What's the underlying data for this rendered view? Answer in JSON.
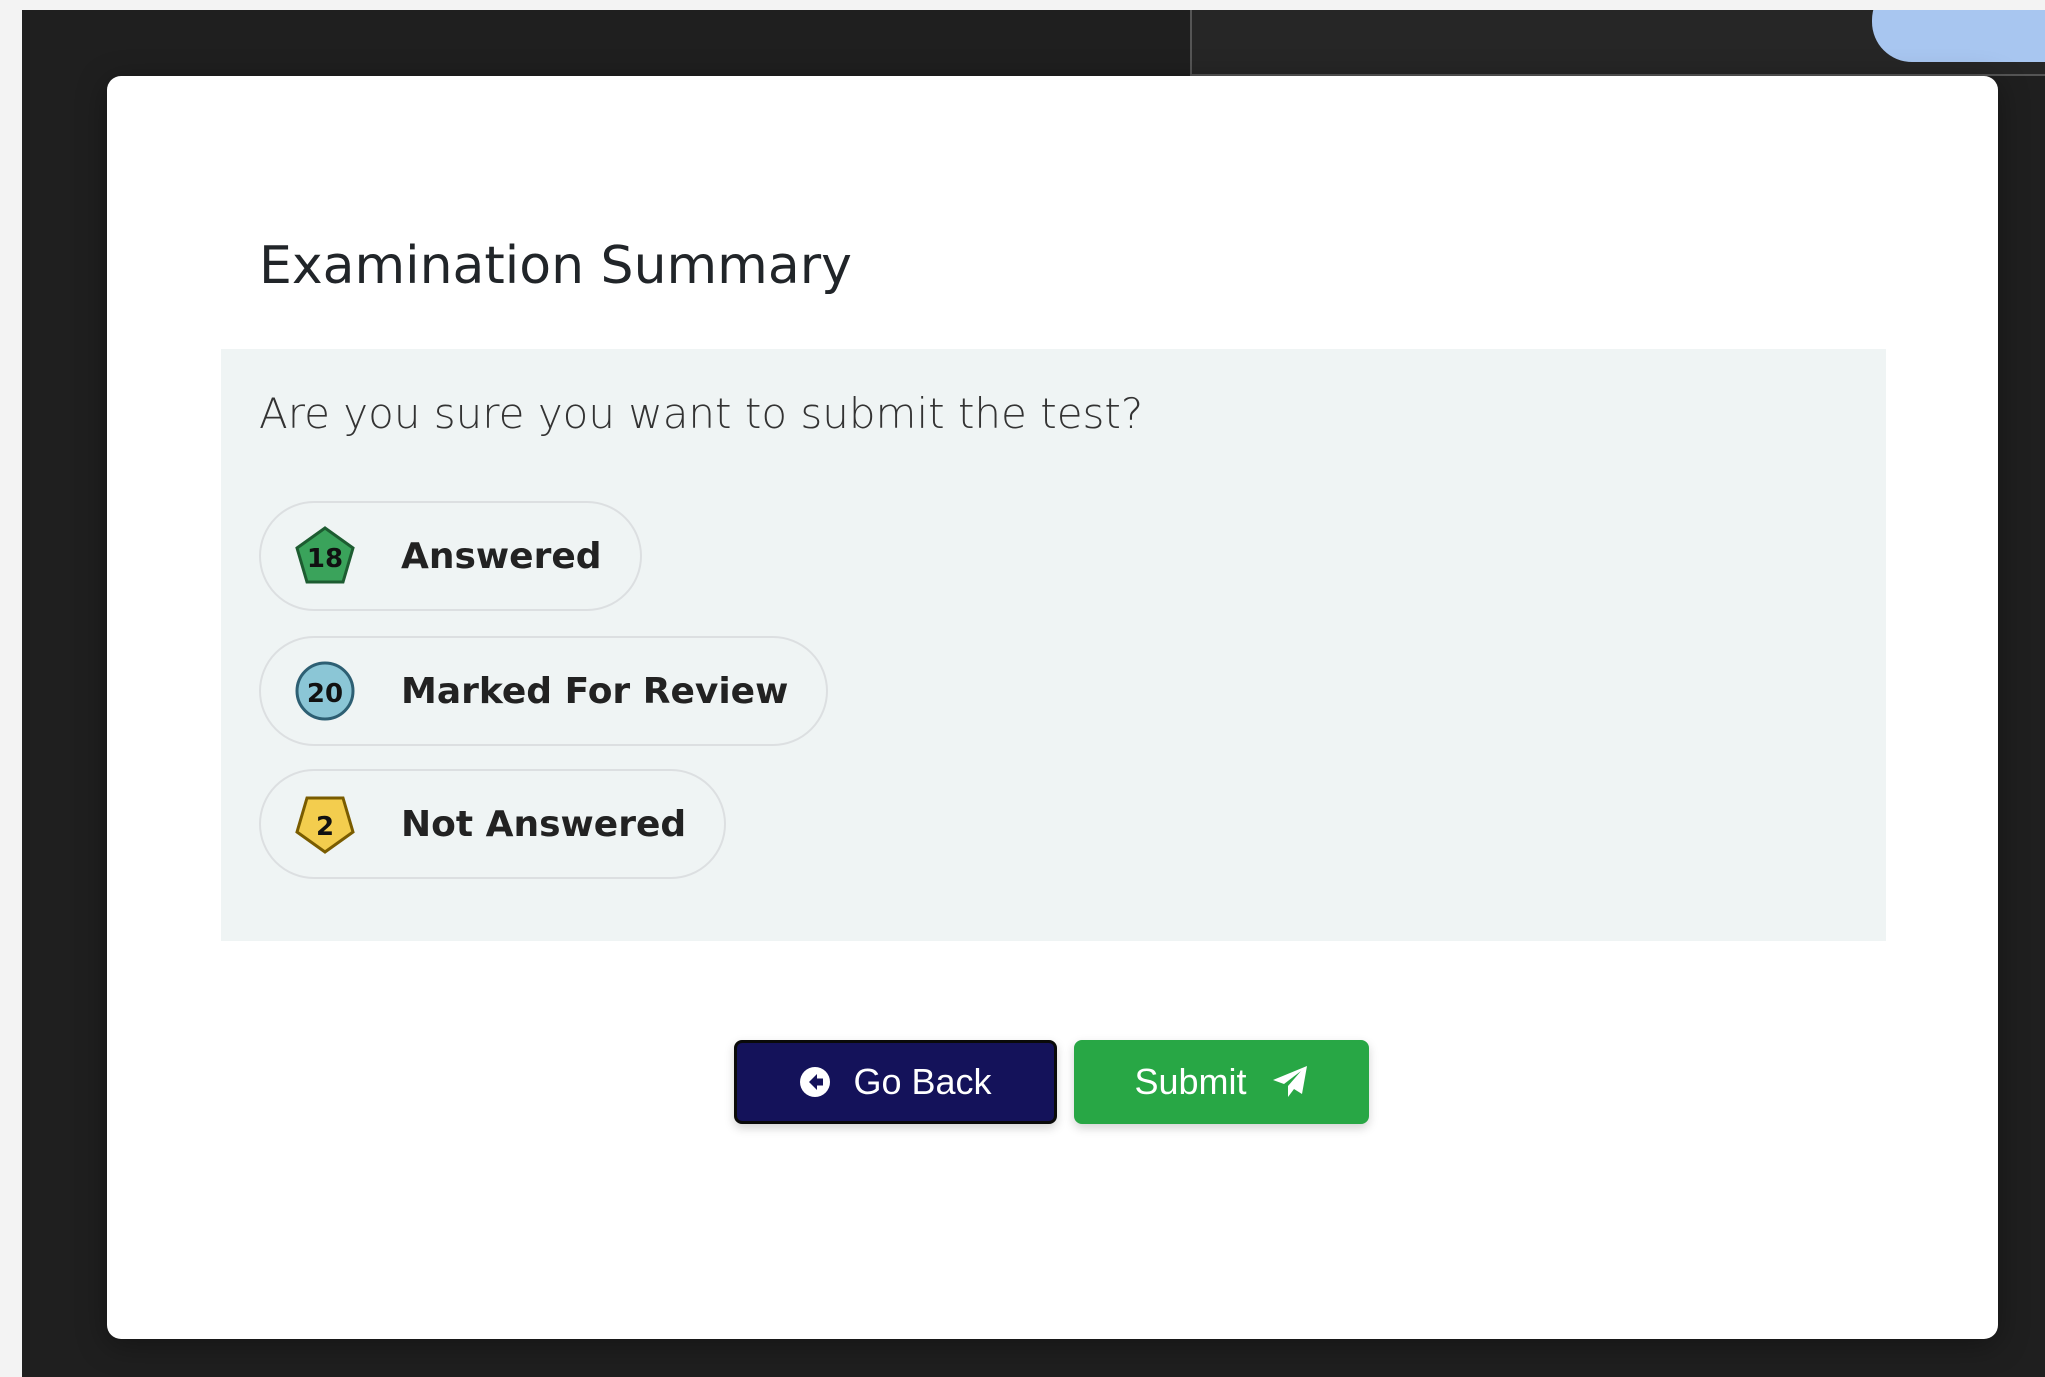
{
  "modal": {
    "title": "Examination Summary",
    "question": "Are you sure you want to submit the test?"
  },
  "statuses": [
    {
      "count": "18",
      "label": "Answered",
      "icon": "green-pentagon-icon",
      "color": "#3aa35b"
    },
    {
      "count": "20",
      "label": "Marked For Review",
      "icon": "blue-circle-icon",
      "color": "#8bc6d6"
    },
    {
      "count": "2",
      "label": "Not Answered",
      "icon": "yellow-pentagon-icon",
      "color": "#f3cd4e"
    }
  ],
  "buttons": {
    "go_back_label": "Go Back",
    "go_back_icon": "arrow-circle-left-icon",
    "submit_label": "Submit",
    "submit_icon": "paper-plane-icon"
  },
  "colors": {
    "go_back_bg": "#14125a",
    "submit_bg": "#28a745",
    "panel_bg": "#eff4f4"
  }
}
